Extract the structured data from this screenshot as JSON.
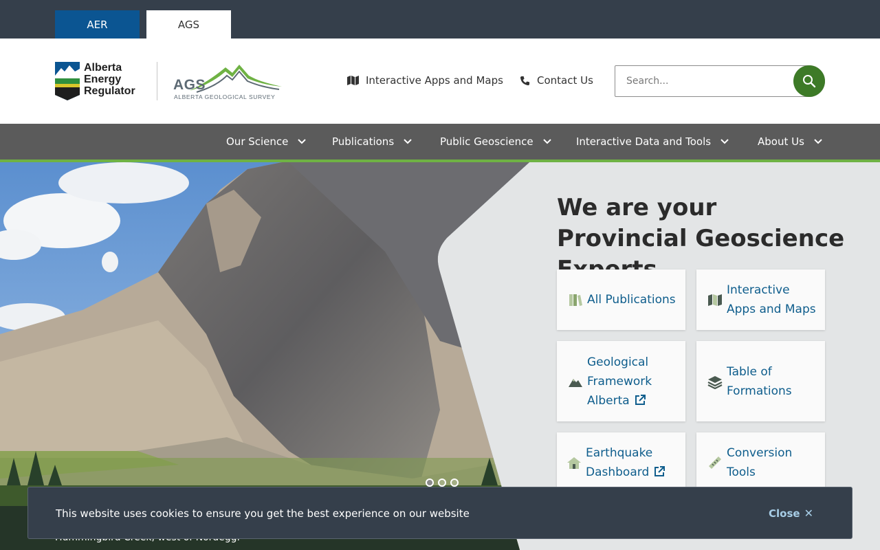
{
  "topbar": {
    "tabs": [
      {
        "label": "AER"
      },
      {
        "label": "AGS"
      }
    ]
  },
  "logos": {
    "aer": {
      "line1": "Alberta",
      "line2": "Energy",
      "line3": "Regulator"
    },
    "ags": {
      "letters": "AGS",
      "subtitle": "ALBERTA GEOLOGICAL SURVEY"
    }
  },
  "header": {
    "links": [
      {
        "label": "Interactive Apps and Maps",
        "icon": "map-icon"
      },
      {
        "label": "Contact Us",
        "icon": "phone-icon"
      }
    ],
    "search": {
      "placeholder": "Search...",
      "value": ""
    }
  },
  "nav": {
    "items": [
      {
        "label": "Our Science"
      },
      {
        "label": "Publications"
      },
      {
        "label": "Public Geoscience"
      },
      {
        "label": "Interactive Data and Tools"
      },
      {
        "label": "About Us"
      }
    ]
  },
  "hero": {
    "title": "We are your Provincial Geoscience Experts",
    "caption": "Hummingbird Creek, west of Nordegg.",
    "slides": 3,
    "active_slide": 1,
    "cards": [
      {
        "line1": "All Publications",
        "icon": "books-icon",
        "external": false
      },
      {
        "line1": "Interactive",
        "line2": "Apps and Maps",
        "icon": "map-icon",
        "external": false
      },
      {
        "line1": "Geological",
        "line2": "Framework",
        "line3": "Alberta",
        "icon": "mountain-icon",
        "external": true
      },
      {
        "line1": "Table of",
        "line2": "Formations",
        "icon": "layers-icon",
        "external": false
      },
      {
        "line1": "Earthquake",
        "line2": "Dashboard",
        "icon": "house-icon",
        "external": true
      },
      {
        "line1": "Conversion",
        "line2": "Tools",
        "icon": "ruler-icon",
        "external": false
      }
    ]
  },
  "cookie": {
    "message": "This website uses cookies to ensure you get the best experience on our website",
    "close_label": "Close"
  },
  "colors": {
    "aer_blue": "#0b5592",
    "dark": "#353f4b",
    "nav": "#5b5b5b",
    "accent_green": "#6fb244",
    "search_green": "#3d7a27",
    "link": "#0e5d8c"
  }
}
